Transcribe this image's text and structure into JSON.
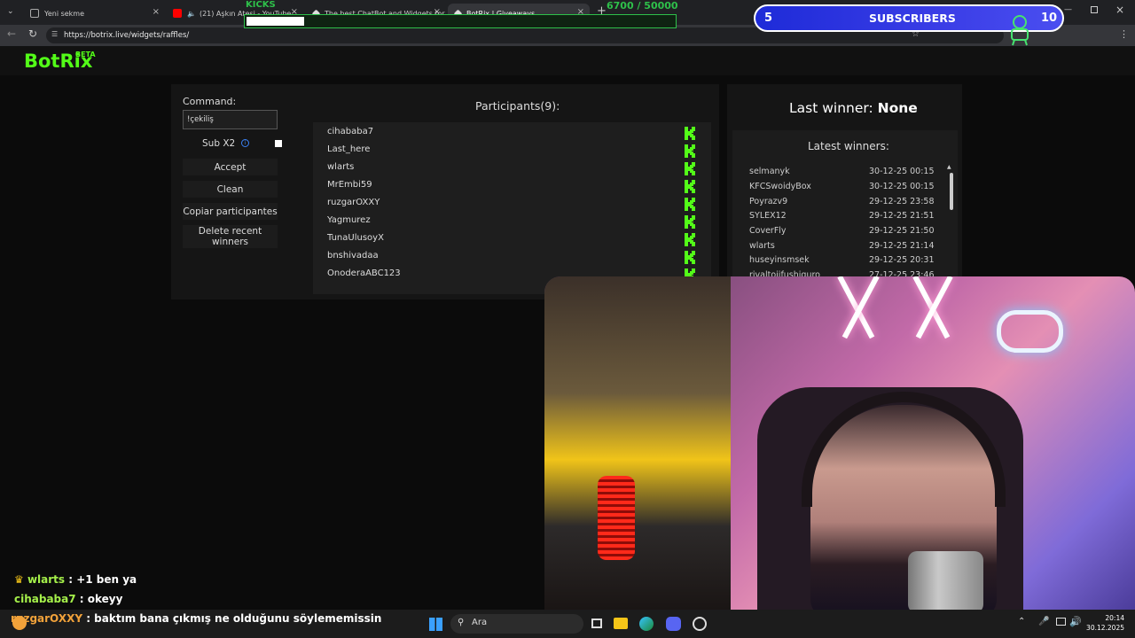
{
  "browser": {
    "tabs": [
      {
        "label": "Yeni sekme",
        "active": false
      },
      {
        "label": "(21) Aşkın Ateşi - YouTube",
        "active": false
      },
      {
        "label": "The best ChatBot and Widgets for",
        "active": false
      },
      {
        "label": "BotRix | Giveaways",
        "active": true
      }
    ],
    "url": "https://botrix.live/widgets/raffles/"
  },
  "site": {
    "logo": "BotRix",
    "badge": "BETA"
  },
  "raffle": {
    "command_label": "Command:",
    "command_value": "!çekiliş",
    "sub_label": "Sub X2",
    "buttons": {
      "accept": "Accept",
      "clean": "Clean",
      "copy": "Copiar participantes",
      "delete": "Delete recent winners"
    },
    "participants_title": "Participants(9):",
    "participants": [
      "cihababa7",
      "Last_here",
      "wlarts",
      "MrEmbi59",
      "ruzgarOXXY",
      "Yagmurez",
      "TunaUlusoyX",
      "bnshivadaa",
      "OnoderaABC123"
    ]
  },
  "winners": {
    "last_label": "Last winner:",
    "last_value": "None",
    "latest_title": "Latest winners:",
    "list": [
      {
        "name": "selmanyk",
        "date": "30-12-25 00:15"
      },
      {
        "name": "KFCSwoidyBox",
        "date": "30-12-25 00:15"
      },
      {
        "name": "Poyrazv9",
        "date": "29-12-25 23:58"
      },
      {
        "name": "SYLEX12",
        "date": "29-12-25 21:51"
      },
      {
        "name": "CoverFly",
        "date": "29-12-25 21:50"
      },
      {
        "name": "wlarts",
        "date": "29-12-25 21:14"
      },
      {
        "name": "huseyinsmsek",
        "date": "29-12-25 20:31"
      },
      {
        "name": "rivaltoiifushiguro",
        "date": "27-12-25 23:46"
      }
    ]
  },
  "overlay": {
    "kicks_label": "KICKS",
    "kicks_count": "6700  / 50000",
    "kicks_progress": 0.134,
    "subs_current": "5",
    "subs_label": "SUBSCRIBERS",
    "subs_goal": "10"
  },
  "chat": [
    {
      "user": "wlarts",
      "message": " : +1 ben ya"
    },
    {
      "user": "cihababa7",
      "message": " : okeyy"
    },
    {
      "user": "ruzgarOXXY",
      "message": " : baktım bana çıkmış ne olduğunu söylememissin"
    }
  ],
  "taskbar": {
    "search_placeholder": "Ara",
    "time": "20:14",
    "date": "30.12.2025"
  },
  "colors": {
    "kick_green": "#53fc18",
    "panel": "#151515",
    "subs_blue": "#2f35e0"
  }
}
